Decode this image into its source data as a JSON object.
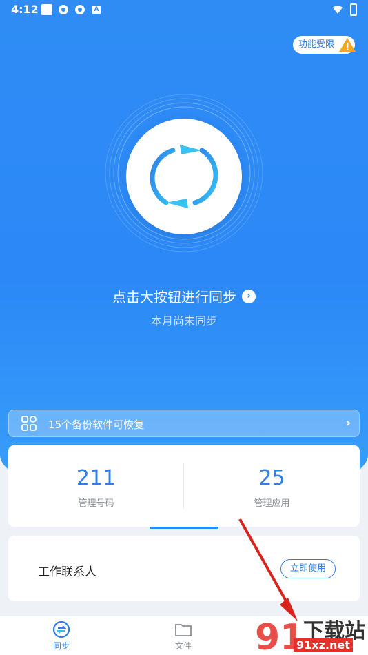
{
  "status_bar": {
    "time": "4:12",
    "notification_letter": "A"
  },
  "badge": {
    "label": "功能受限"
  },
  "sync": {
    "title": "点击大按钮进行同步",
    "subtitle": "本月尚未同步"
  },
  "restore": {
    "label": "15个备份软件可恢复"
  },
  "stats": [
    {
      "value": "211",
      "label": "管理号码"
    },
    {
      "value": "25",
      "label": "管理应用"
    }
  ],
  "contact": {
    "label": "工作联系人",
    "button": "立即使用"
  },
  "nav": [
    {
      "label": "同步",
      "icon": "sync-nav-icon",
      "active": true
    },
    {
      "label": "文件",
      "icon": "folder-icon",
      "active": false
    }
  ],
  "watermark": {
    "text_top": "下载站",
    "text_bottom": "91xz.net"
  },
  "colors": {
    "primary": "#2f8cf5",
    "accent": "#2f7ee8",
    "warning": "#f5a623",
    "arrow": "#d9231d"
  }
}
